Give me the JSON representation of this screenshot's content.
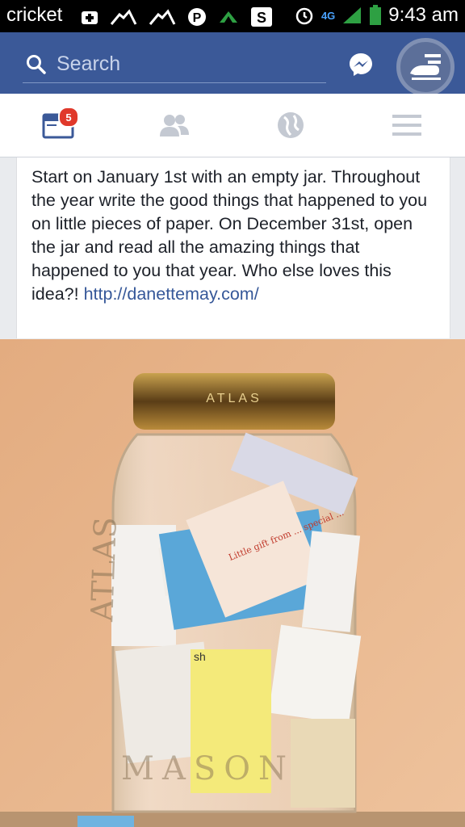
{
  "status_bar": {
    "carrier": "cricket",
    "network": "4G",
    "time": "9:43 am"
  },
  "top_bar": {
    "search_placeholder": "Search"
  },
  "nav": {
    "notifications_badge": "5"
  },
  "post": {
    "text": "Start on January 1st with an empty jar. Throughout the year write the good things that happened to you on little pieces of paper. On December 31st, open the jar and read all the amazing things that happened to you that year. Who else loves this idea?!",
    "link": "http://danettemay.com/"
  },
  "photo": {
    "jar_lid_text": "ATLAS",
    "jar_side_text_left": "ATLAS",
    "jar_bottom_text": "MASON",
    "note_sticky_text": "sh",
    "note_handwriting": "Little gift from ... special ..."
  },
  "colors": {
    "facebook_blue": "#3b5998",
    "status_bar_bg": "#000000",
    "link_color": "#365899",
    "badge_red": "#e0392b"
  }
}
